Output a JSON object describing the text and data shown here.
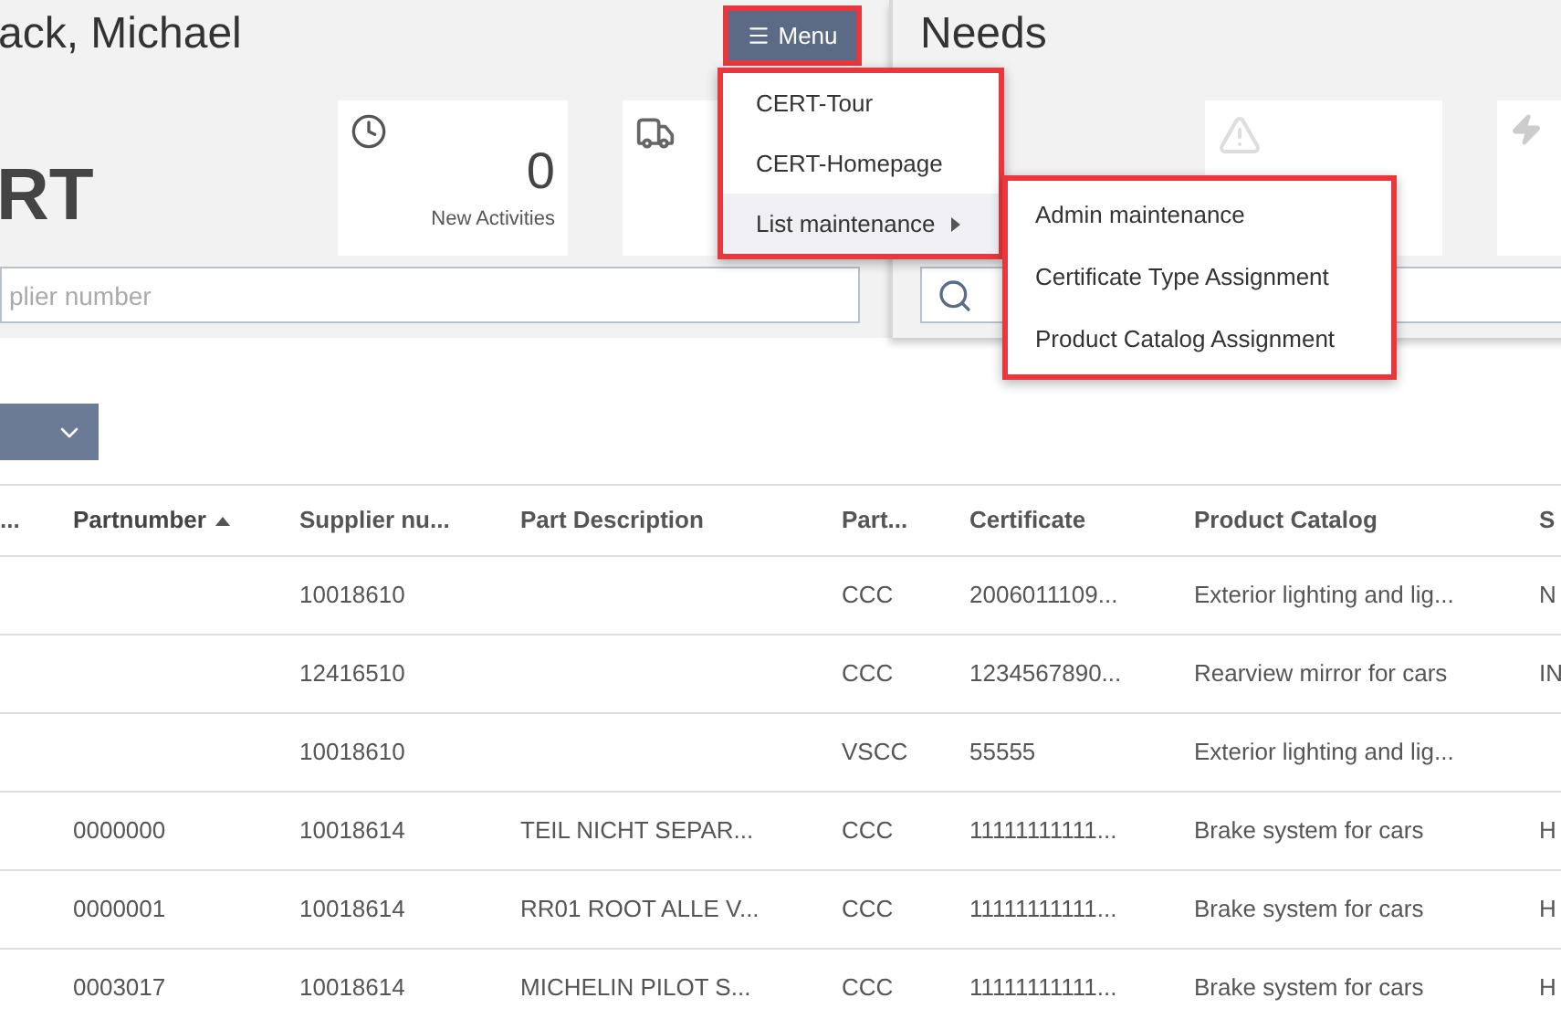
{
  "left_panel": {
    "title": "ack, Michael",
    "brand": "RT",
    "tiles": [
      {
        "kind": "clock",
        "count": "0",
        "label": "New Activities"
      },
      {
        "kind": "truck"
      }
    ],
    "search": {
      "placeholder": "plier number"
    }
  },
  "menu_button": {
    "label": "Menu"
  },
  "menu": {
    "items": [
      {
        "label": "CERT-Tour",
        "selected": false,
        "has_submenu": false
      },
      {
        "label": "CERT-Homepage",
        "selected": false,
        "has_submenu": false
      },
      {
        "label": "List maintenance",
        "selected": true,
        "has_submenu": true
      }
    ]
  },
  "submenu": {
    "items": [
      "Admin maintenance",
      "Certificate Type Assignment",
      "Product Catalog Assignment"
    ]
  },
  "right_panel": {
    "title": "Needs",
    "tiles": [
      {
        "kind": "warning"
      },
      {
        "kind": "bolt"
      }
    ]
  },
  "table": {
    "columns": [
      {
        "label": "...",
        "sorted": false
      },
      {
        "label": "Partnumber",
        "sorted": true
      },
      {
        "label": "Supplier nu...",
        "sorted": false
      },
      {
        "label": "Part Description",
        "sorted": false
      },
      {
        "label": "Part...",
        "sorted": false
      },
      {
        "label": "Certificate",
        "sorted": false
      },
      {
        "label": "Product Catalog",
        "sorted": false
      },
      {
        "label": "S",
        "sorted": false
      }
    ],
    "rows": [
      [
        "",
        "",
        "10018610",
        "",
        "CCC",
        "2006011109...",
        "Exterior lighting and lig...",
        "N"
      ],
      [
        "",
        "",
        "12416510",
        "",
        "CCC",
        "1234567890...",
        "Rearview mirror for cars",
        "IN"
      ],
      [
        "",
        "",
        "10018610",
        "",
        "VSCC",
        "55555",
        "Exterior lighting and lig...",
        ""
      ],
      [
        "",
        "0000000",
        "10018614",
        "TEIL NICHT SEPAR...",
        "CCC",
        "11111111111...",
        "Brake system for cars",
        "H"
      ],
      [
        "",
        "0000001",
        "10018614",
        "RR01 ROOT ALLE V...",
        "CCC",
        "11111111111...",
        "Brake system for cars",
        "H"
      ],
      [
        "",
        "0003017",
        "10018614",
        "MICHELIN PILOT S...",
        "CCC",
        "11111111111...",
        "Brake system for cars",
        "H"
      ]
    ]
  }
}
